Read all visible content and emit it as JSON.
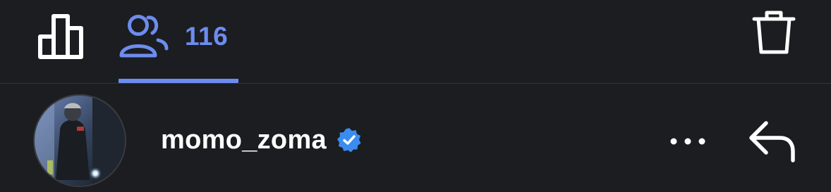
{
  "colors": {
    "accent": "#6d8cf0",
    "background": "#1b1d20",
    "verified": "#3b8cf0",
    "icon": "#ffffff"
  },
  "tabs": [
    {
      "icon": "bar-chart-icon",
      "selected": false
    },
    {
      "icon": "viewers-icon",
      "count": "116",
      "selected": true
    }
  ],
  "toolbar": {
    "delete_icon": "trash-icon"
  },
  "viewer": {
    "username": "momo_zoma",
    "verified": true,
    "more_icon": "more-horizontal-icon",
    "reply_icon": "reply-arrow-icon"
  }
}
